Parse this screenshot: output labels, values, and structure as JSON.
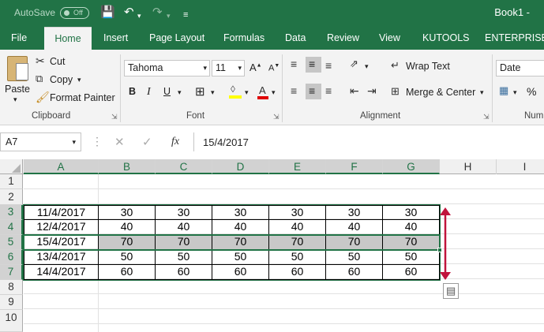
{
  "titlebar": {
    "autosave": "AutoSave",
    "toggle": "Off",
    "workbook": "Book1 -"
  },
  "tabs": [
    "File",
    "Home",
    "Insert",
    "Page Layout",
    "Formulas",
    "Data",
    "Review",
    "View",
    "KUTOOLS",
    "ENTERPRISE"
  ],
  "clipboard": {
    "paste": "Paste",
    "cut": "Cut",
    "copy": "Copy",
    "format_painter": "Format Painter",
    "label": "Clipboard"
  },
  "font": {
    "name": "Tahoma",
    "size": "11",
    "label": "Font"
  },
  "alignment": {
    "wrap": "Wrap Text",
    "merge": "Merge & Center",
    "label": "Alignment"
  },
  "number": {
    "format": "Date",
    "label": "Num"
  },
  "formula_bar": {
    "name_box": "A7",
    "fx": "fx",
    "value": "15/4/2017"
  },
  "columns": [
    "A",
    "B",
    "C",
    "D",
    "E",
    "F",
    "G",
    "H",
    "I"
  ],
  "rows": [
    "1",
    "2",
    "3",
    "4",
    "5",
    "6",
    "7",
    "8",
    "9",
    "10"
  ],
  "table": [
    [
      "11/4/2017",
      "30",
      "30",
      "30",
      "30",
      "30",
      "30"
    ],
    [
      "12/4/2017",
      "40",
      "40",
      "40",
      "40",
      "40",
      "40"
    ],
    [
      "15/4/2017",
      "70",
      "70",
      "70",
      "70",
      "70",
      "70"
    ],
    [
      "13/4/2017",
      "50",
      "50",
      "50",
      "50",
      "50",
      "50"
    ],
    [
      "14/4/2017",
      "60",
      "60",
      "60",
      "60",
      "60",
      "60"
    ]
  ],
  "colors": {
    "excel_green": "#217346",
    "arrow_red": "#c0143c",
    "highlight": "#c8c8c8"
  }
}
